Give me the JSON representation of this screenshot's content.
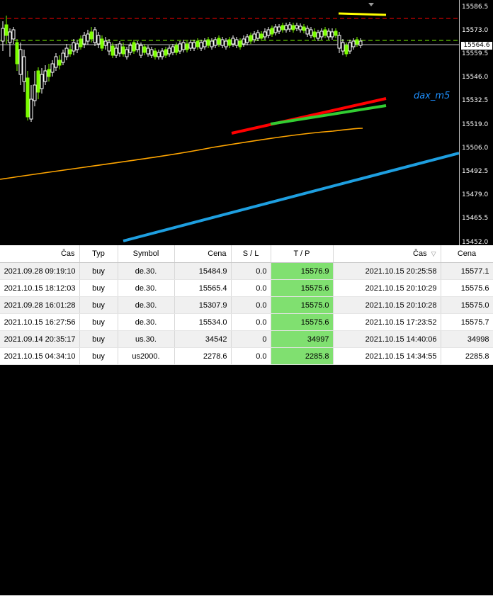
{
  "chart": {
    "label": "dax_m5",
    "current_price": "15564.6",
    "price_ticks": [
      "15586.5",
      "15573.0",
      "15559.5",
      "15546.0",
      "15532.5",
      "15519.0",
      "15506.0",
      "15492.5",
      "15479.0",
      "15465.5",
      "15452.0"
    ],
    "colors": {
      "background": "#000000",
      "bull_candle": "#ffffff",
      "bear_candle": "#7cfc00",
      "red_line": "#ff0000",
      "green_line": "#32cd32",
      "orange_line": "#ffa500",
      "blue_line": "#1e9fe0",
      "yellow_line": "#ffff00",
      "red_dashed_level": "#ff0000",
      "green_dashed_level": "#7cfc00",
      "current_price_line": "#c0c0c0"
    }
  },
  "table": {
    "headers": [
      "Čas",
      "Typ",
      "Symbol",
      "Cena",
      "S / L",
      "T / P",
      "Čas",
      "Cena"
    ],
    "rows": [
      [
        "2021.09.28 09:19:10",
        "buy",
        "de.30.",
        "15484.9",
        "0.0",
        "15576.9",
        "2021.10.15 20:25:58",
        "15577.1"
      ],
      [
        "2021.10.15 18:12:03",
        "buy",
        "de.30.",
        "15565.4",
        "0.0",
        "15575.6",
        "2021.10.15 20:10:29",
        "15575.6"
      ],
      [
        "2021.09.28 16:01:28",
        "buy",
        "de.30.",
        "15307.9",
        "0.0",
        "15575.0",
        "2021.10.15 20:10:28",
        "15575.0"
      ],
      [
        "2021.10.15 16:27:56",
        "buy",
        "de.30.",
        "15534.0",
        "0.0",
        "15575.6",
        "2021.10.15 17:23:52",
        "15575.7"
      ],
      [
        "2021.09.14 20:35:17",
        "buy",
        "us.30.",
        "34542",
        "0",
        "34997",
        "2021.10.15 14:40:06",
        "34998"
      ],
      [
        "2021.10.15 04:34:10",
        "buy",
        "us2000.",
        "2278.6",
        "0.0",
        "2285.8",
        "2021.10.15 14:34:55",
        "2285.8"
      ]
    ]
  }
}
